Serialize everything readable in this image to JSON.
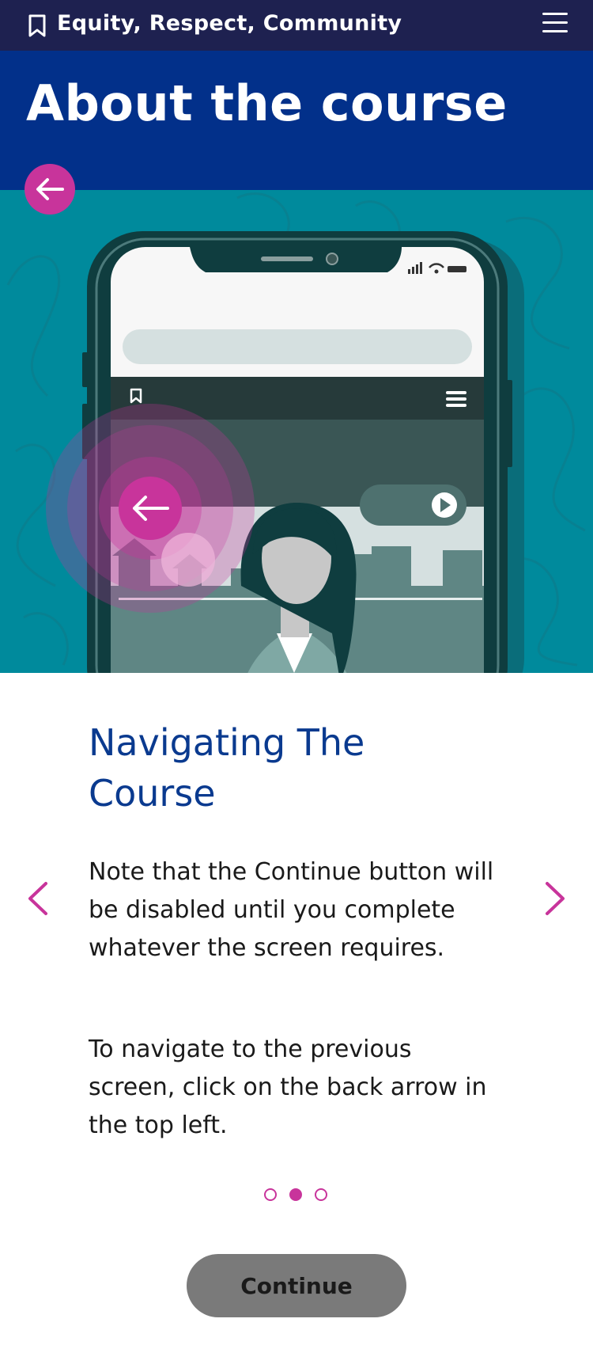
{
  "topbar": {
    "title": "Equity, Respect, Community",
    "bookmark_icon": "bookmark-icon",
    "menu_icon": "hamburger-menu-icon"
  },
  "header": {
    "title": "About the course"
  },
  "back_button": {
    "icon": "arrow-left-icon"
  },
  "hero": {
    "description_icon": "phone-illustration",
    "colors": {
      "background": "#008a9c",
      "accent": "#c8349b",
      "phone_frame": "#0f3d3f"
    }
  },
  "slide": {
    "title": "Navigating The Course",
    "paragraphs": [
      "Note that the Continue button will be disabled until you complete whatever the screen requires.",
      "To navigate to the previous screen, click on the back arrow in the top left."
    ]
  },
  "carousel": {
    "prev_icon": "chevron-left-icon",
    "next_icon": "chevron-right-icon",
    "total_slides": 3,
    "active_slide": 2
  },
  "continue_button": {
    "label": "Continue",
    "disabled": true
  },
  "colors": {
    "topbar": "#1e2150",
    "header": "#02308a",
    "title_text": "#0a3a8f",
    "accent": "#c8349b",
    "button_disabled": "#7a7a7a"
  }
}
